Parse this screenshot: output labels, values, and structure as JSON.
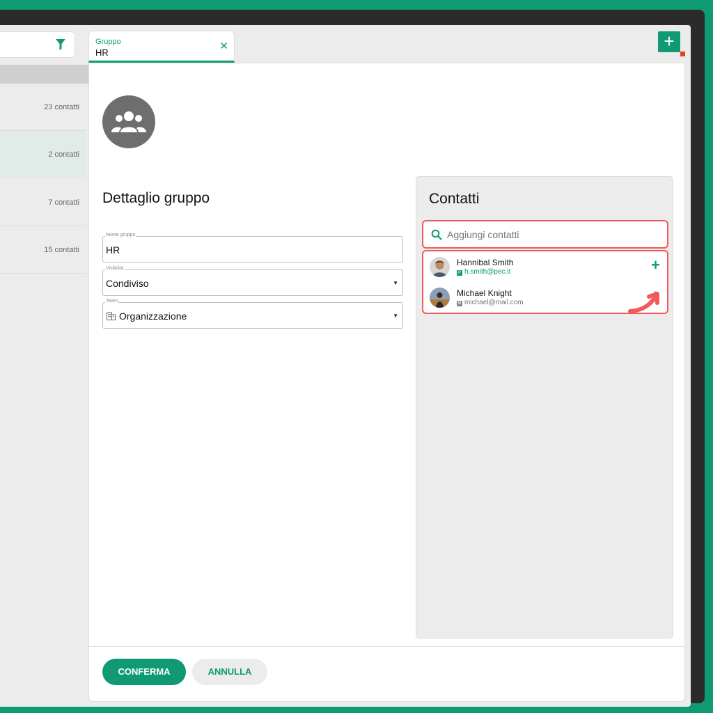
{
  "sidebar": {
    "groups": [
      {
        "count": "23 contatti"
      },
      {
        "count": "2 contatti",
        "selected": true
      },
      {
        "count": "7 contatti"
      },
      {
        "count": "15 contatti"
      }
    ]
  },
  "tab": {
    "type": "Gruppo",
    "name": "HR",
    "close_icon": "close-icon"
  },
  "detail": {
    "title": "Dettaglio gruppo",
    "name_label": "Nome gruppo",
    "name_value": "HR",
    "visibility_label": "Visibilità",
    "visibility_value": "Condiviso",
    "team_label": "Team",
    "team_value": "Organizzazione"
  },
  "contacts": {
    "title": "Contatti",
    "search_placeholder": "Aggiungi contatti",
    "items": [
      {
        "name": "Hannibal Smith",
        "badge": "P",
        "email": "h.smith@pec.it",
        "email_color": "#0f9a73"
      },
      {
        "name": "Michael Knight",
        "badge": "M",
        "email": "michael@mail.com",
        "email_color": "#777777"
      }
    ]
  },
  "footer": {
    "confirm": "CONFERMA",
    "cancel": "ANNULLA"
  },
  "colors": {
    "accent": "#0f9a73",
    "highlight": "#f05a5a"
  }
}
